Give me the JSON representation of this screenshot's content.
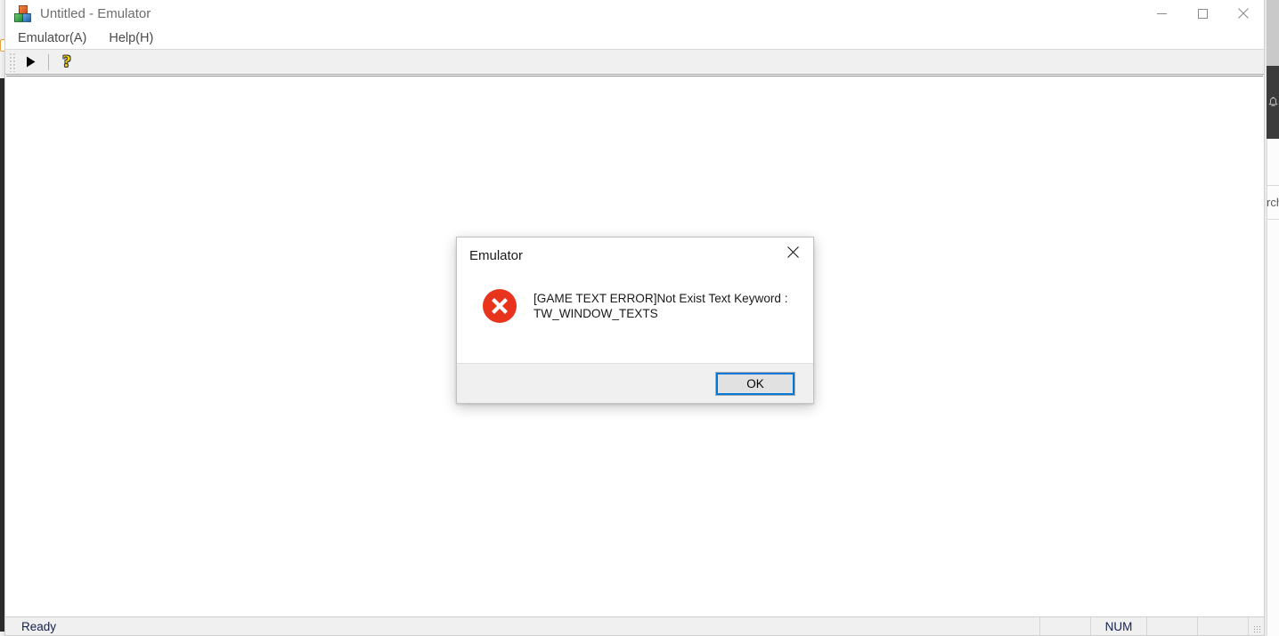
{
  "window": {
    "title": "Untitled - Emulator",
    "icon": "mfc-blocks-icon",
    "caption": {
      "minimize": "minimize-icon",
      "maximize": "maximize-icon",
      "close": "close-icon"
    }
  },
  "menubar": {
    "items": [
      {
        "label": "Emulator(A)"
      },
      {
        "label": "Help(H)"
      }
    ]
  },
  "toolbar": {
    "buttons": [
      {
        "name": "run-button",
        "icon": "play-triangle-icon"
      },
      {
        "name": "help-button",
        "icon": "question-mark-icon",
        "glyph": "?"
      }
    ]
  },
  "statusbar": {
    "message": "Ready",
    "panes": [
      {
        "label": ""
      },
      {
        "label": "NUM"
      },
      {
        "label": ""
      },
      {
        "label": ""
      }
    ]
  },
  "dialog": {
    "title": "Emulator",
    "close_icon": "close-icon",
    "icon": "error-icon",
    "message_lines": [
      "[GAME TEXT ERROR]Not Exist Text Keyword :",
      "TW_WINDOW_TEXTS"
    ],
    "ok_label": "OK"
  },
  "background": {
    "notification_icon": "bell-icon",
    "right_text_fragment": "rch"
  },
  "colors": {
    "error_red": "#E81123",
    "focus_blue": "#0078D7",
    "toolbar_bg": "#F0F0F0",
    "status_text": "#16214D",
    "title_text": "#6D6D6D"
  }
}
